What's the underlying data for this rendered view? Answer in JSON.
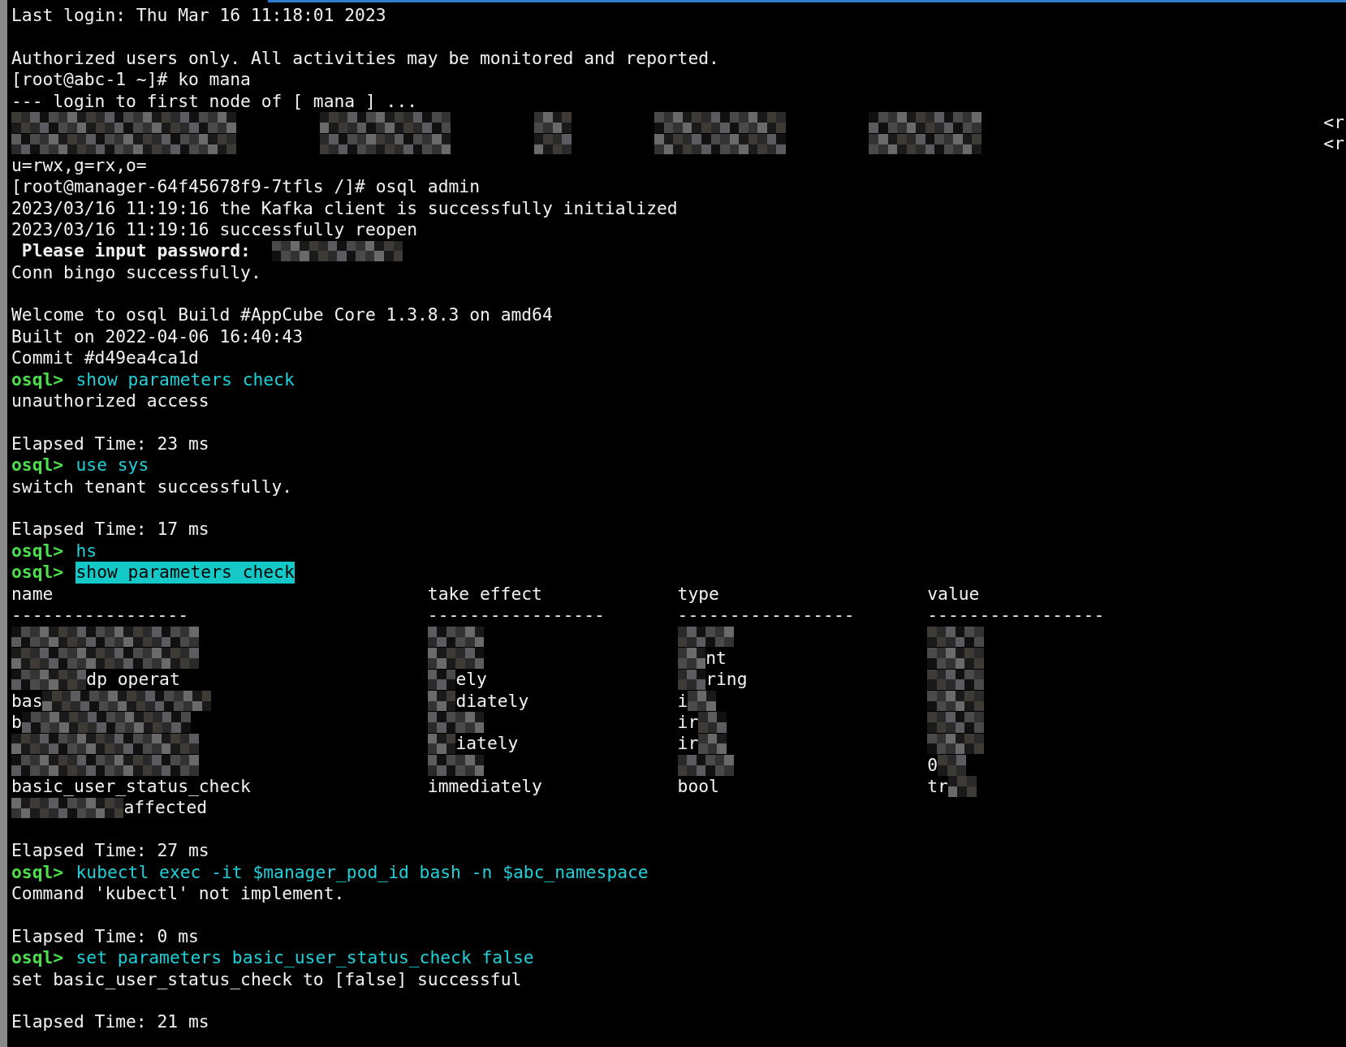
{
  "terminal": {
    "lines": [
      {
        "kind": "text",
        "text": "Last login: Thu Mar 16 11:18:01 2023"
      },
      {
        "kind": "blank"
      },
      {
        "kind": "text",
        "text": "Authorized users only. All activities may be monitored and reported."
      },
      {
        "kind": "text",
        "text": "[root@abc-1 ~]# ko mana"
      },
      {
        "kind": "text",
        "text": "--- login to first node of [ mana ] ..."
      },
      {
        "kind": "redacted",
        "trailing": "<r"
      },
      {
        "kind": "redacted",
        "trailing": "<r"
      },
      {
        "kind": "text",
        "text": "u=rwx,g=rx,o="
      },
      {
        "kind": "text",
        "text": "[root@manager-64f45678f9-7tfls /]# osql admin"
      },
      {
        "kind": "text",
        "text": "2023/03/16 11:19:16 the Kafka client is successfully initialized"
      },
      {
        "kind": "text",
        "text": "2023/03/16 11:19:16 successfully reopen"
      },
      {
        "kind": "text_masked",
        "text": " Please input password:",
        "bold": true
      },
      {
        "kind": "text",
        "text": "Conn bingo successfully."
      },
      {
        "kind": "blank"
      },
      {
        "kind": "text",
        "text": "Welcome to osql Build #AppCube Core 1.3.8.3 on amd64"
      },
      {
        "kind": "text",
        "text": "Built on 2022-04-06 16:40:43"
      },
      {
        "kind": "text",
        "text": "Commit #d49ea4ca1d"
      },
      {
        "kind": "prompt",
        "prompt": "osql>",
        "command": "show parameters check",
        "highlighted": false
      },
      {
        "kind": "text",
        "text": "unauthorized access"
      },
      {
        "kind": "blank"
      },
      {
        "kind": "text",
        "text": "Elapsed Time: 23 ms"
      },
      {
        "kind": "prompt",
        "prompt": "osql>",
        "command": "use sys",
        "highlighted": false
      },
      {
        "kind": "text",
        "text": "switch tenant successfully."
      },
      {
        "kind": "blank"
      },
      {
        "kind": "text",
        "text": "Elapsed Time: 17 ms"
      },
      {
        "kind": "prompt",
        "prompt": "osql>",
        "command": "hs",
        "highlighted": false
      },
      {
        "kind": "prompt",
        "prompt": "osql>",
        "command": "show parameters check",
        "highlighted": true
      },
      {
        "kind": "table",
        "columns": [
          "name",
          "take effect",
          "type",
          "value"
        ],
        "rule": "-----------------",
        "rows": [
          [
            {
              "kind": "masked"
            },
            {
              "kind": "masked"
            },
            {
              "kind": "masked"
            },
            {
              "kind": "masked"
            }
          ],
          [
            {
              "kind": "masked"
            },
            {
              "kind": "masked"
            },
            {
              "kind": "masked_text",
              "text": "nt"
            },
            {
              "kind": "masked"
            }
          ],
          [
            {
              "kind": "masked_text",
              "text": "dp operat"
            },
            {
              "kind": "masked_text",
              "text": "ely"
            },
            {
              "kind": "masked_text",
              "text": "ring"
            },
            {
              "kind": "masked"
            }
          ],
          [
            {
              "kind": "text_masked",
              "text": "bas"
            },
            {
              "kind": "masked_text",
              "text": "diately"
            },
            {
              "kind": "text_masked",
              "text": "i"
            },
            {
              "kind": "masked"
            }
          ],
          [
            {
              "kind": "text_masked",
              "text": "b"
            },
            {
              "kind": "masked"
            },
            {
              "kind": "text_masked",
              "text": "ir"
            },
            {
              "kind": "masked"
            }
          ],
          [
            {
              "kind": "masked"
            },
            {
              "kind": "masked_text",
              "text": "iately"
            },
            {
              "kind": "text_masked",
              "text": "ir"
            },
            {
              "kind": "masked"
            }
          ],
          [
            {
              "kind": "masked"
            },
            {
              "kind": "masked"
            },
            {
              "kind": "masked"
            },
            {
              "kind": "text_masked",
              "text": "0"
            }
          ],
          [
            {
              "kind": "text",
              "text": "basic_user_status_check"
            },
            {
              "kind": "text",
              "text": "immediately"
            },
            {
              "kind": "text",
              "text": "bool"
            },
            {
              "kind": "text_masked",
              "text": "tr"
            }
          ]
        ]
      },
      {
        "kind": "masked_text",
        "text": "affected"
      },
      {
        "kind": "blank"
      },
      {
        "kind": "text",
        "text": "Elapsed Time: 27 ms"
      },
      {
        "kind": "prompt",
        "prompt": "osql>",
        "command": "kubectl exec -it $manager_pod_id bash -n $abc_namespace",
        "highlighted": false
      },
      {
        "kind": "text",
        "text": "Command 'kubectl' not implement."
      },
      {
        "kind": "blank"
      },
      {
        "kind": "text",
        "text": "Elapsed Time: 0 ms"
      },
      {
        "kind": "prompt",
        "prompt": "osql>",
        "command": "set parameters basic_user_status_check false",
        "highlighted": false
      },
      {
        "kind": "text",
        "text": "set basic_user_status_check to [false] successful"
      },
      {
        "kind": "blank"
      },
      {
        "kind": "text",
        "text": "Elapsed Time: 21 ms"
      }
    ]
  }
}
